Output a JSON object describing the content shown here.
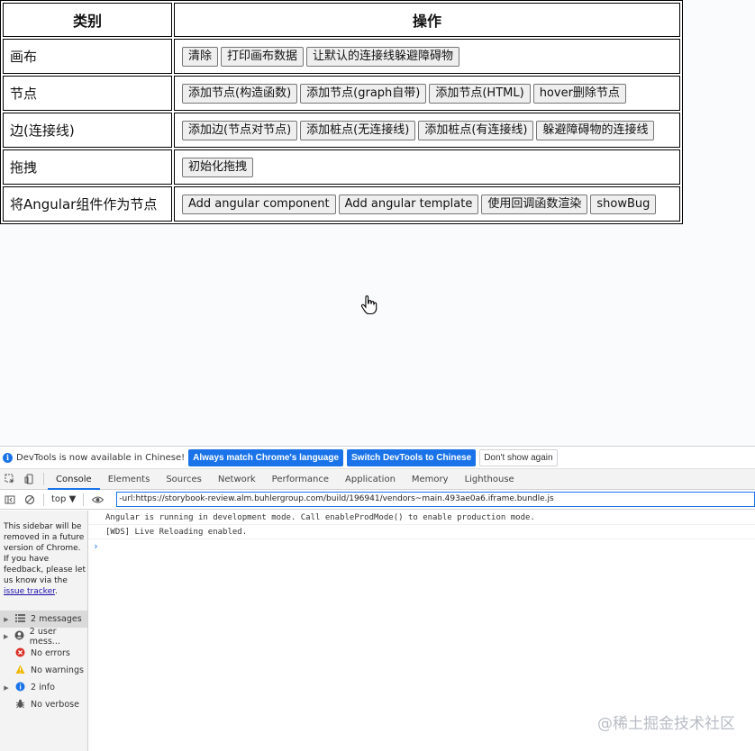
{
  "table": {
    "headers": [
      "类别",
      "操作"
    ],
    "rows": [
      {
        "category": "画布",
        "buttons": [
          "清除",
          "打印画布数据",
          "让默认的连接线躲避障碍物"
        ]
      },
      {
        "category": "节点",
        "buttons": [
          "添加节点(构造函数)",
          "添加节点(graph自带)",
          "添加节点(HTML)",
          "hover删除节点"
        ]
      },
      {
        "category": "边(连接线)",
        "buttons": [
          "添加边(节点对节点)",
          "添加桩点(无连接线)",
          "添加桩点(有连接线)",
          "躲避障碍物的连接线"
        ]
      },
      {
        "category": "拖拽",
        "buttons": [
          "初始化拖拽"
        ]
      },
      {
        "category": "将Angular组件作为节点",
        "buttons": [
          "Add angular component",
          "Add angular template",
          "使用回调函数渲染",
          "showBug"
        ]
      }
    ]
  },
  "devtools": {
    "infobar": {
      "message": "DevTools is now available in Chinese!",
      "btn_match": "Always match Chrome's language",
      "btn_switch": "Switch DevTools to Chinese",
      "btn_dismiss": "Don't show again"
    },
    "tabs": [
      "Console",
      "Elements",
      "Sources",
      "Network",
      "Performance",
      "Application",
      "Memory",
      "Lighthouse"
    ],
    "context": "top",
    "filter_value": "-url:https://storybook-review.alm.buhlergroup.com/build/196941/vendors~main.493ae0a6.iframe.bundle.js",
    "sidebar_note": "This sidebar will be removed in a future version of Chrome. If you have feedback, please let us know via the",
    "sidebar_link": "issue tracker",
    "sidebar_items": [
      {
        "label": "2 messages",
        "icon": "list-icon"
      },
      {
        "label": "2 user mess...",
        "icon": "user-icon"
      },
      {
        "label": "No errors",
        "icon": "error-icon"
      },
      {
        "label": "No warnings",
        "icon": "warning-icon"
      },
      {
        "label": "2 info",
        "icon": "info-icon"
      },
      {
        "label": "No verbose",
        "icon": "bug-icon"
      }
    ],
    "messages": [
      "Angular is running in development mode. Call enableProdMode() to enable production mode.",
      "[WDS] Live Reloading enabled."
    ],
    "prompt": "›"
  },
  "watermark": "@稀土掘金技术社区",
  "colors": {
    "accent": "#1a73e8",
    "error": "#d93025",
    "warning": "#f2b600"
  }
}
